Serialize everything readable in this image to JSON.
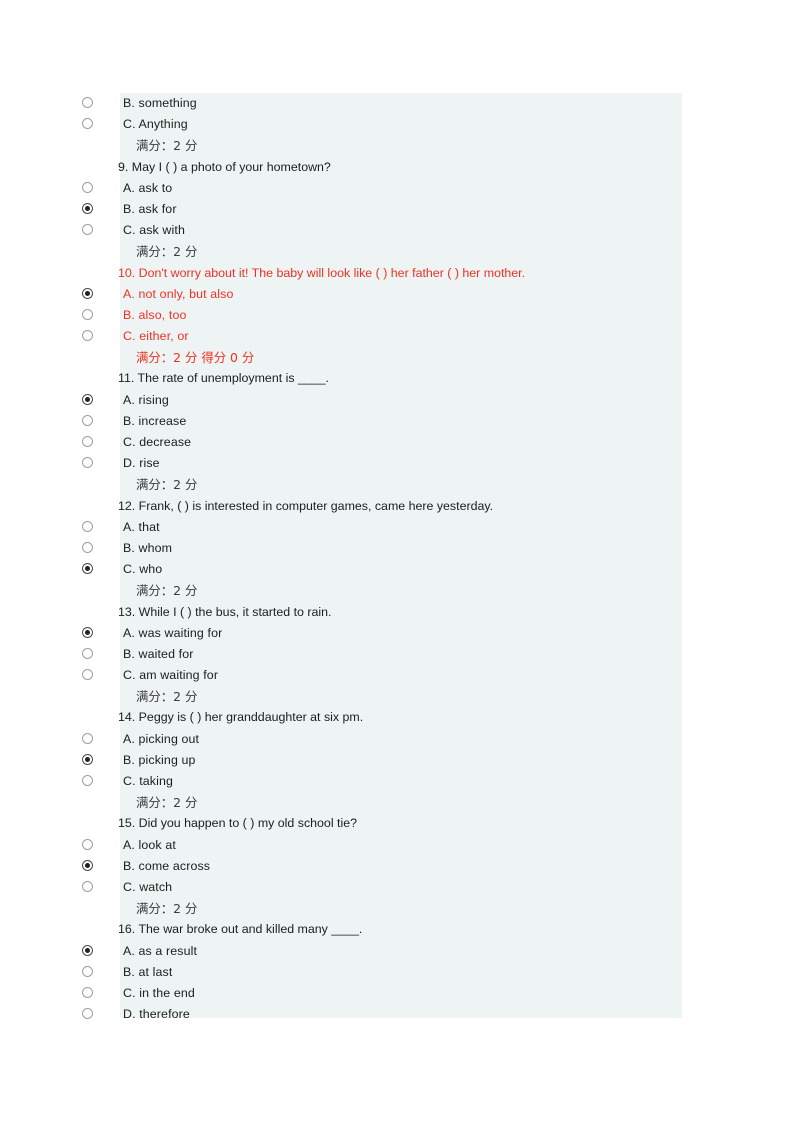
{
  "page": {
    "background": "#ffffff",
    "panel_background": "#eef3f3",
    "gutter_background": "#ffffff",
    "text_color": "#1d1d1d",
    "wrong_color": "#ef3124"
  },
  "rows": [
    {
      "kind": "option",
      "label": "B. something",
      "checked": false,
      "red": false
    },
    {
      "kind": "option",
      "label": "C. Anything",
      "checked": false,
      "red": false
    },
    {
      "kind": "score",
      "label": "满分：2 分",
      "red": false
    },
    {
      "kind": "question",
      "label": "9.  May I ( ) a photo of your hometown?",
      "red": false
    },
    {
      "kind": "option",
      "label": "A. ask to",
      "checked": false,
      "red": false
    },
    {
      "kind": "option",
      "label": "B. ask for",
      "checked": true,
      "red": false
    },
    {
      "kind": "option",
      "label": "C. ask with",
      "checked": false,
      "red": false
    },
    {
      "kind": "score",
      "label": "满分：2 分",
      "red": false
    },
    {
      "kind": "question",
      "label": "10.  Don't worry about it! The baby will look like ( ) her father ( ) her mother.",
      "red": true
    },
    {
      "kind": "option",
      "label": "A. not only, but also",
      "checked": true,
      "red": true
    },
    {
      "kind": "option",
      "label": "B. also, too",
      "checked": false,
      "red": true
    },
    {
      "kind": "option",
      "label": "C. either, or",
      "checked": false,
      "red": true
    },
    {
      "kind": "score",
      "label": "满分：2 分 得分 0 分",
      "red": true
    },
    {
      "kind": "question",
      "label": "11.  The rate of unemployment is ____.",
      "red": false
    },
    {
      "kind": "option",
      "label": "A. rising",
      "checked": true,
      "red": false
    },
    {
      "kind": "option",
      "label": "B. increase",
      "checked": false,
      "red": false
    },
    {
      "kind": "option",
      "label": "C. decrease",
      "checked": false,
      "red": false
    },
    {
      "kind": "option",
      "label": "D. rise",
      "checked": false,
      "red": false
    },
    {
      "kind": "score",
      "label": "满分：2 分",
      "red": false
    },
    {
      "kind": "question",
      "label": "12.  Frank, ( ) is interested in computer games, came here yesterday.",
      "red": false
    },
    {
      "kind": "option",
      "label": "A. that",
      "checked": false,
      "red": false
    },
    {
      "kind": "option",
      "label": "B. whom",
      "checked": false,
      "red": false
    },
    {
      "kind": "option",
      "label": "C. who",
      "checked": true,
      "red": false
    },
    {
      "kind": "score",
      "label": "满分：2 分",
      "red": false
    },
    {
      "kind": "question",
      "label": "13.  While I ( ) the bus, it started to rain.",
      "red": false
    },
    {
      "kind": "option",
      "label": "A. was waiting for",
      "checked": true,
      "red": false
    },
    {
      "kind": "option",
      "label": "B. waited for",
      "checked": false,
      "red": false
    },
    {
      "kind": "option",
      "label": "C. am waiting for",
      "checked": false,
      "red": false
    },
    {
      "kind": "score",
      "label": "满分：2 分",
      "red": false
    },
    {
      "kind": "question",
      "label": "14.  Peggy is ( ) her granddaughter at six pm.",
      "red": false
    },
    {
      "kind": "option",
      "label": "A. picking out",
      "checked": false,
      "red": false
    },
    {
      "kind": "option",
      "label": "B. picking up",
      "checked": true,
      "red": false
    },
    {
      "kind": "option",
      "label": "C. taking",
      "checked": false,
      "red": false
    },
    {
      "kind": "score",
      "label": "满分：2 分",
      "red": false
    },
    {
      "kind": "question",
      "label": "15.  Did you happen to ( ) my old school tie?",
      "red": false
    },
    {
      "kind": "option",
      "label": "A. look at",
      "checked": false,
      "red": false
    },
    {
      "kind": "option",
      "label": "B. come across",
      "checked": true,
      "red": false
    },
    {
      "kind": "option",
      "label": "C. watch",
      "checked": false,
      "red": false
    },
    {
      "kind": "score",
      "label": "满分：2 分",
      "red": false
    },
    {
      "kind": "question",
      "label": "16.  The war broke out and killed many ____.",
      "red": false
    },
    {
      "kind": "option",
      "label": "A. as a result",
      "checked": true,
      "red": false
    },
    {
      "kind": "option",
      "label": "B. at last",
      "checked": false,
      "red": false
    },
    {
      "kind": "option",
      "label": "C. in the end",
      "checked": false,
      "red": false
    },
    {
      "kind": "option",
      "label": "D. therefore",
      "checked": false,
      "red": false
    }
  ]
}
